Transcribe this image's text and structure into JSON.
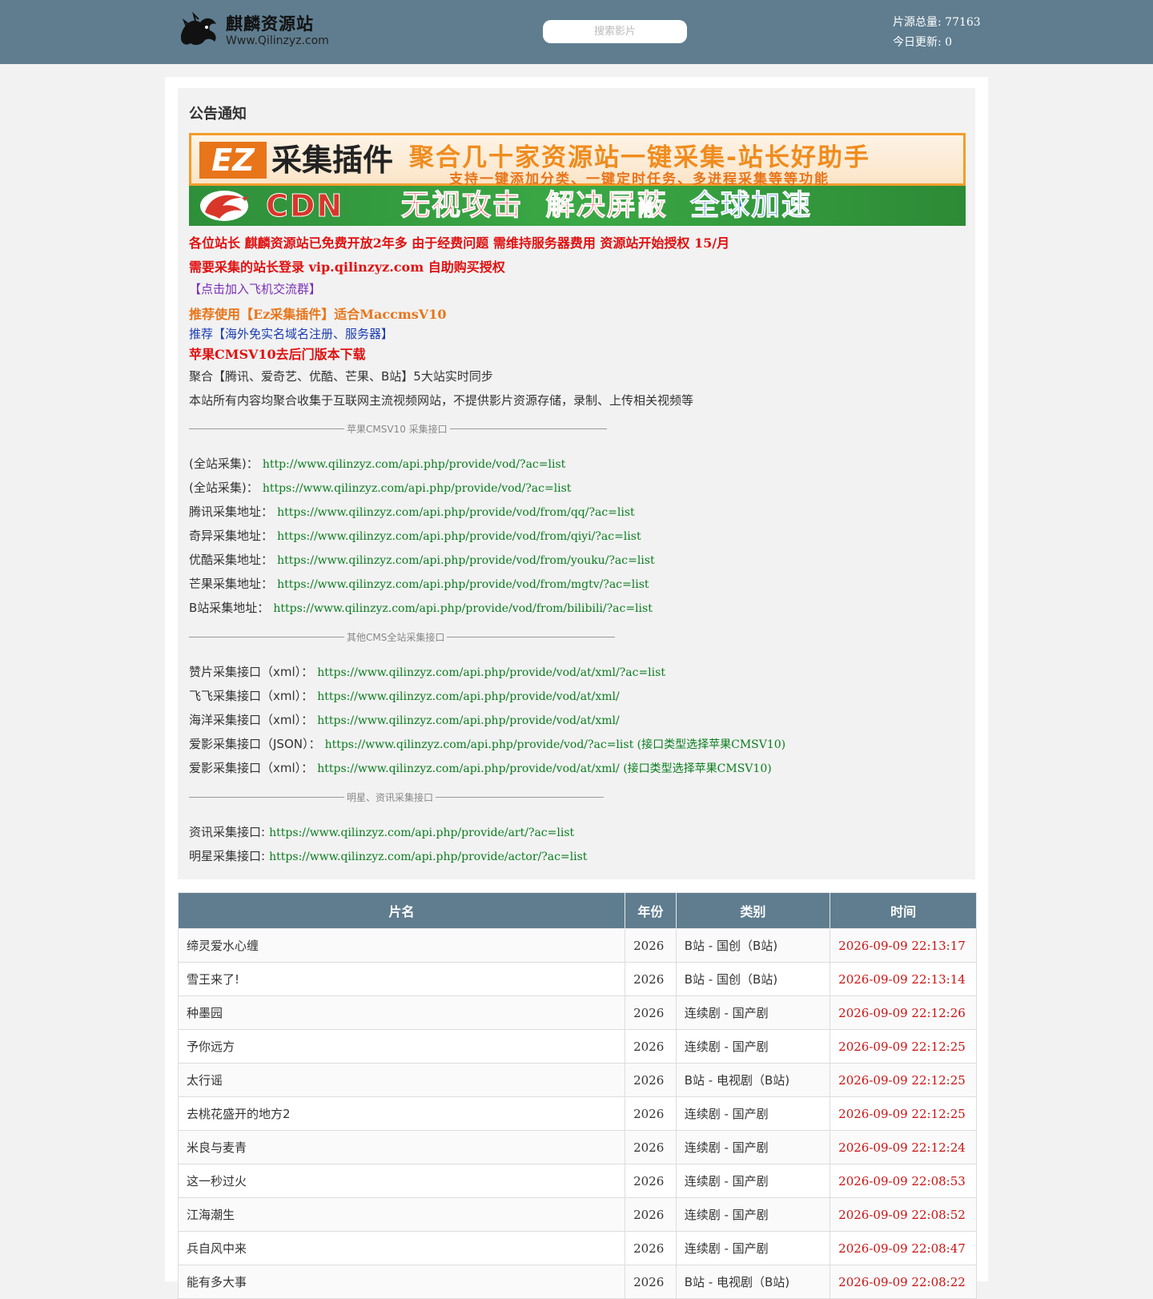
{
  "header": {
    "logo_cn": "麒麟资源站",
    "logo_en": "Www.Qilinzyz.com",
    "search_placeholder": "搜索影片",
    "total_label": "片源总量:",
    "total_value": "77163",
    "today_label": "今日更新:",
    "today_value": "0",
    "colors": {
      "bar": "#5f7d8f"
    }
  },
  "notice": {
    "title": "公告通知",
    "banner_ez": {
      "box": "EZ",
      "title": "采集插件",
      "slogan": "聚合几十家资源站一键采集-站长好助手",
      "sub": "支持一键添加分类、一键定时任务、多进程采集等等功能"
    },
    "banner_cdn": {
      "text": "CDN",
      "slogan_1": "无视攻击",
      "slogan_2": "解决屏蔽",
      "slogan_3": "全球加速"
    },
    "lines": [
      "各位站长 麒麟资源站已免费开放2年多 由于经费问题 需维持服务器费用 资源站开始授权 15/月",
      "需要采集的站长登录 vip.qilinzyz.com 自助购买授权",
      "【点击加入飞机交流群】",
      "推荐使用【Ez采集插件】适合MaccmsV10",
      "推荐【海外免实名域名注册、服务器】",
      "苹果CMSV10去后门版本下载",
      "聚合【腾讯、爱奇艺、优酷、芒果、B站】5大站实时同步",
      "本站所有内容均聚合收集于互联网主流视频网站，不提供影片资源存储，录制、上传相关视频等"
    ],
    "section1": {
      "title": "苹果CMSV10 采集接口",
      "items": [
        {
          "label": "(全站采集)：",
          "url": "http://www.qilinzyz.com/api.php/provide/vod/?ac=list"
        },
        {
          "label": "(全站采集)：",
          "url": "https://www.qilinzyz.com/api.php/provide/vod/?ac=list"
        },
        {
          "label": "腾讯采集地址：",
          "url": "https://www.qilinzyz.com/api.php/provide/vod/from/qq/?ac=list"
        },
        {
          "label": "奇异采集地址：",
          "url": "https://www.qilinzyz.com/api.php/provide/vod/from/qiyi/?ac=list"
        },
        {
          "label": "优酷采集地址：",
          "url": "https://www.qilinzyz.com/api.php/provide/vod/from/youku/?ac=list"
        },
        {
          "label": "芒果采集地址：",
          "url": "https://www.qilinzyz.com/api.php/provide/vod/from/mgtv/?ac=list"
        },
        {
          "label": "B站采集地址：",
          "url": "https://www.qilinzyz.com/api.php/provide/vod/from/bilibili/?ac=list"
        }
      ]
    },
    "section2": {
      "title": "其他CMS全站采集接口",
      "items": [
        {
          "label": "赞片采集接口（xml）：",
          "url": "https://www.qilinzyz.com/api.php/provide/vod/at/xml/?ac=list"
        },
        {
          "label": "飞飞采集接口（xml）：",
          "url": "https://www.qilinzyz.com/api.php/provide/vod/at/xml/"
        },
        {
          "label": "海洋采集接口（xml）：",
          "url": "https://www.qilinzyz.com/api.php/provide/vod/at/xml/"
        },
        {
          "label": "爱影采集接口（JSON）：",
          "url": "https://www.qilinzyz.com/api.php/provide/vod/?ac=list (接口类型选择苹果CMSV10)"
        },
        {
          "label": "爱影采集接口（xml）：",
          "url": "https://www.qilinzyz.com/api.php/provide/vod/at/xml/ (接口类型选择苹果CMSV10)"
        }
      ]
    },
    "section3": {
      "title": "明星、资讯采集接口",
      "items": [
        {
          "label": "资讯采集接口:",
          "url": "https://www.qilinzyz.com/api.php/provide/art/?ac=list"
        },
        {
          "label": "明星采集接口:",
          "url": "https://www.qilinzyz.com/api.php/provide/actor/?ac=list"
        }
      ]
    }
  },
  "table": {
    "headers": [
      "片名",
      "年份",
      "类别",
      "时间"
    ],
    "rows": [
      [
        "缔灵爱水心缠",
        "2026",
        "B站 - 国创（B站)",
        "2026-09-09 22:13:17"
      ],
      [
        "雪王来了!",
        "2026",
        "B站 - 国创（B站)",
        "2026-09-09 22:13:14"
      ],
      [
        "种墨园",
        "2026",
        "连续剧 - 国产剧",
        "2026-09-09 22:12:26"
      ],
      [
        "予你远方",
        "2026",
        "连续剧 - 国产剧",
        "2026-09-09 22:12:25"
      ],
      [
        "太行谣",
        "2026",
        "B站 - 电视剧（B站)",
        "2026-09-09 22:12:25"
      ],
      [
        "去桃花盛开的地方2",
        "2026",
        "连续剧 - 国产剧",
        "2026-09-09 22:12:25"
      ],
      [
        "米良与麦青",
        "2026",
        "连续剧 - 国产剧",
        "2026-09-09 22:12:24"
      ],
      [
        "这一秒过火",
        "2026",
        "连续剧 - 国产剧",
        "2026-09-09 22:08:53"
      ],
      [
        "江海潮生",
        "2026",
        "连续剧 - 国产剧",
        "2026-09-09 22:08:52"
      ],
      [
        "兵自风中来",
        "2026",
        "连续剧 - 国产剧",
        "2026-09-09 22:08:47"
      ],
      [
        "能有多大事",
        "2026",
        "B站 - 电视剧（B站)",
        "2026-09-09 22:08:22"
      ]
    ]
  }
}
